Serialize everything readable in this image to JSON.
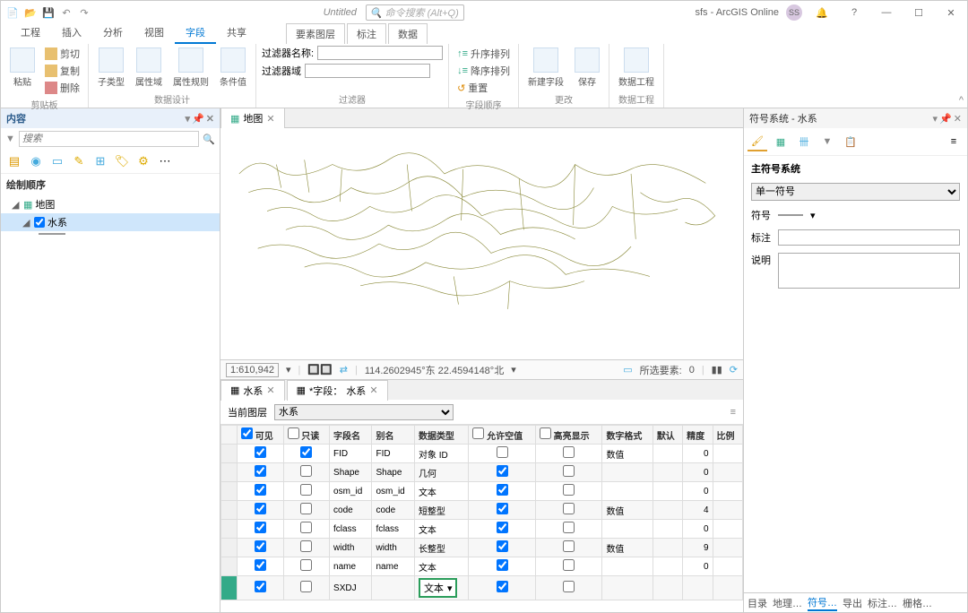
{
  "titlebar": {
    "doc_title": "Untitled",
    "search_placeholder": "命令搜索 (Alt+Q)",
    "user_text": "sfs - ArcGIS Online",
    "avatar_initials": "SS"
  },
  "ribbon_tabs": [
    "工程",
    "插入",
    "分析",
    "视图",
    "字段",
    "共享"
  ],
  "ribbon_active_index": 4,
  "ribbon_context_tabs": [
    "要素图层",
    "标注",
    "数据"
  ],
  "ribbon_groups": {
    "clipboard": {
      "paste": "粘贴",
      "cut": "剪切",
      "copy": "复制",
      "delete": "删除",
      "label": "剪贴板"
    },
    "design": {
      "subtype": "子类型",
      "domain": "属性域",
      "rules": "属性规则",
      "contingent": "条件值",
      "label": "数据设计"
    },
    "filter": {
      "name_label": "过滤器名称:",
      "domain_label": "过滤器域",
      "label": "过滤器"
    },
    "order": {
      "asc": "升序排列",
      "desc": "降序排列",
      "reset": "重置",
      "label": "字段顺序"
    },
    "changes": {
      "newfield": "新建字段",
      "save": "保存",
      "label": "更改"
    },
    "dataeng": {
      "btn": "数据工程",
      "label": "数据工程"
    }
  },
  "contents": {
    "title": "内容",
    "search_placeholder": "搜索",
    "section": "绘制顺序",
    "map_name": "地图",
    "layer_name": "水系"
  },
  "map": {
    "tab_label": "地图",
    "scale": "1:610,942",
    "coords": "114.2602945°东 22.4594148°北",
    "selected_label": "所选要素:",
    "selected_count": "0"
  },
  "attr": {
    "tab1": "水系",
    "tab2_prefix": "*字段：",
    "tab2_name": "水系",
    "current_layer_label": "当前图层",
    "current_layer_value": "水系",
    "columns": [
      "可见",
      "只读",
      "字段名",
      "别名",
      "数据类型",
      "允许空值",
      "高亮显示",
      "数字格式",
      "默认",
      "精度",
      "比例"
    ],
    "rows": [
      {
        "visible": true,
        "readonly": true,
        "field": "FID",
        "alias": "FID",
        "type": "对象 ID",
        "null": false,
        "hl": false,
        "fmt": "数值",
        "def": "",
        "prec": "0",
        "scale": ""
      },
      {
        "visible": true,
        "readonly": false,
        "field": "Shape",
        "alias": "Shape",
        "type": "几何",
        "null": true,
        "hl": false,
        "fmt": "",
        "def": "",
        "prec": "0",
        "scale": ""
      },
      {
        "visible": true,
        "readonly": false,
        "field": "osm_id",
        "alias": "osm_id",
        "type": "文本",
        "null": true,
        "hl": false,
        "fmt": "",
        "def": "",
        "prec": "0",
        "scale": ""
      },
      {
        "visible": true,
        "readonly": false,
        "field": "code",
        "alias": "code",
        "type": "短整型",
        "null": true,
        "hl": false,
        "fmt": "数值",
        "def": "",
        "prec": "4",
        "scale": ""
      },
      {
        "visible": true,
        "readonly": false,
        "field": "fclass",
        "alias": "fclass",
        "type": "文本",
        "null": true,
        "hl": false,
        "fmt": "",
        "def": "",
        "prec": "0",
        "scale": ""
      },
      {
        "visible": true,
        "readonly": false,
        "field": "width",
        "alias": "width",
        "type": "长整型",
        "null": true,
        "hl": false,
        "fmt": "数值",
        "def": "",
        "prec": "9",
        "scale": ""
      },
      {
        "visible": true,
        "readonly": false,
        "field": "name",
        "alias": "name",
        "type": "文本",
        "null": true,
        "hl": false,
        "fmt": "",
        "def": "",
        "prec": "0",
        "scale": ""
      },
      {
        "visible": true,
        "readonly": false,
        "field": "SXDJ",
        "alias": "",
        "type": "文本",
        "null": true,
        "hl": false,
        "fmt": "",
        "def": "",
        "prec": "",
        "scale": "",
        "editing": true
      }
    ]
  },
  "symbology": {
    "title": "符号系统 - 水系",
    "primary_label": "主符号系统",
    "dropdown_value": "单一符号",
    "symbol_label": "符号",
    "label_label": "标注",
    "desc_label": "说明"
  },
  "bottom_tabs": [
    "目录",
    "地理…",
    "符号…",
    "导出",
    "标注…",
    "栅格…"
  ],
  "bottom_active": 2
}
